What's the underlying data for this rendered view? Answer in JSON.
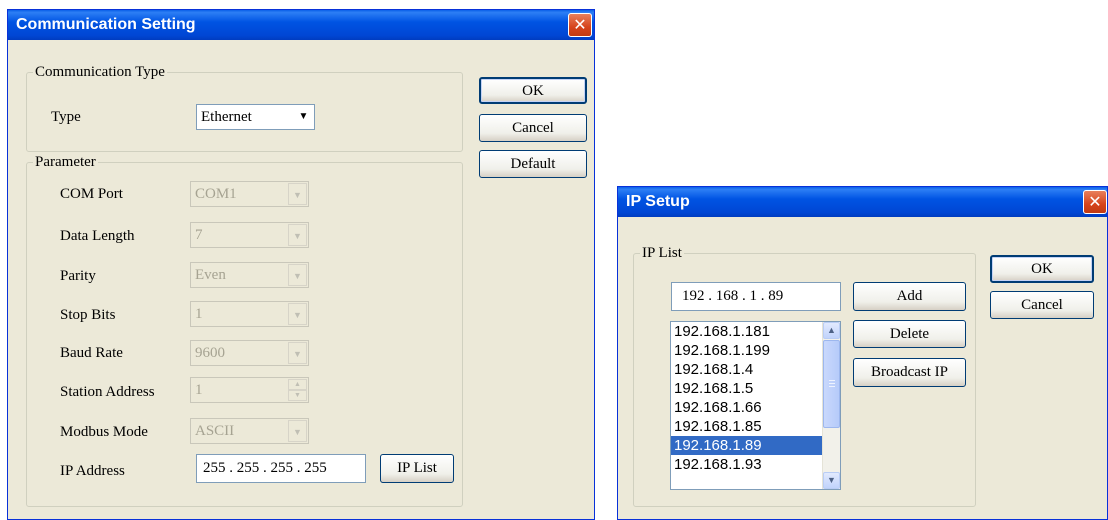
{
  "comm_dialog": {
    "title": "Communication Setting",
    "close": "✕",
    "group_type": "Communication Type",
    "type_label": "Type",
    "type_value": "Ethernet",
    "group_param": "Parameter",
    "com_port_label": "COM Port",
    "com_port_value": "COM1",
    "data_length_label": "Data Length",
    "data_length_value": "7",
    "parity_label": "Parity",
    "parity_value": "Even",
    "stop_bits_label": "Stop Bits",
    "stop_bits_value": "1",
    "baud_rate_label": "Baud Rate",
    "baud_rate_value": "9600",
    "station_label": "Station Address",
    "station_value": "1",
    "modbus_label": "Modbus Mode",
    "modbus_value": "ASCII",
    "ip_label": "IP Address",
    "ip_value": "255 . 255 . 255 . 255",
    "ip_list_button": "IP List",
    "ok": "OK",
    "cancel": "Cancel",
    "default": "Default"
  },
  "ip_dialog": {
    "title": "IP Setup",
    "close": "✕",
    "group": "IP List",
    "ip_input": "192 . 168 .   1   .  89",
    "add": "Add",
    "delete": "Delete",
    "broadcast": "Broadcast IP",
    "ok": "OK",
    "cancel": "Cancel",
    "items": [
      "192.168.1.181",
      "192.168.1.199",
      "192.168.1.4",
      "192.168.1.5",
      "192.168.1.66",
      "192.168.1.85",
      "192.168.1.89",
      "192.168.1.93"
    ],
    "selected_index": 6
  },
  "colors": {
    "titlebar": "#0054e3",
    "dialog_bg": "#ece9d8",
    "selection": "#316ac5",
    "close": "#d6441c"
  },
  "icons": {
    "dropdown": "chevron-down-icon",
    "close": "close-icon",
    "scroll_up": "scroll-up-icon",
    "scroll_down": "scroll-down-icon"
  }
}
